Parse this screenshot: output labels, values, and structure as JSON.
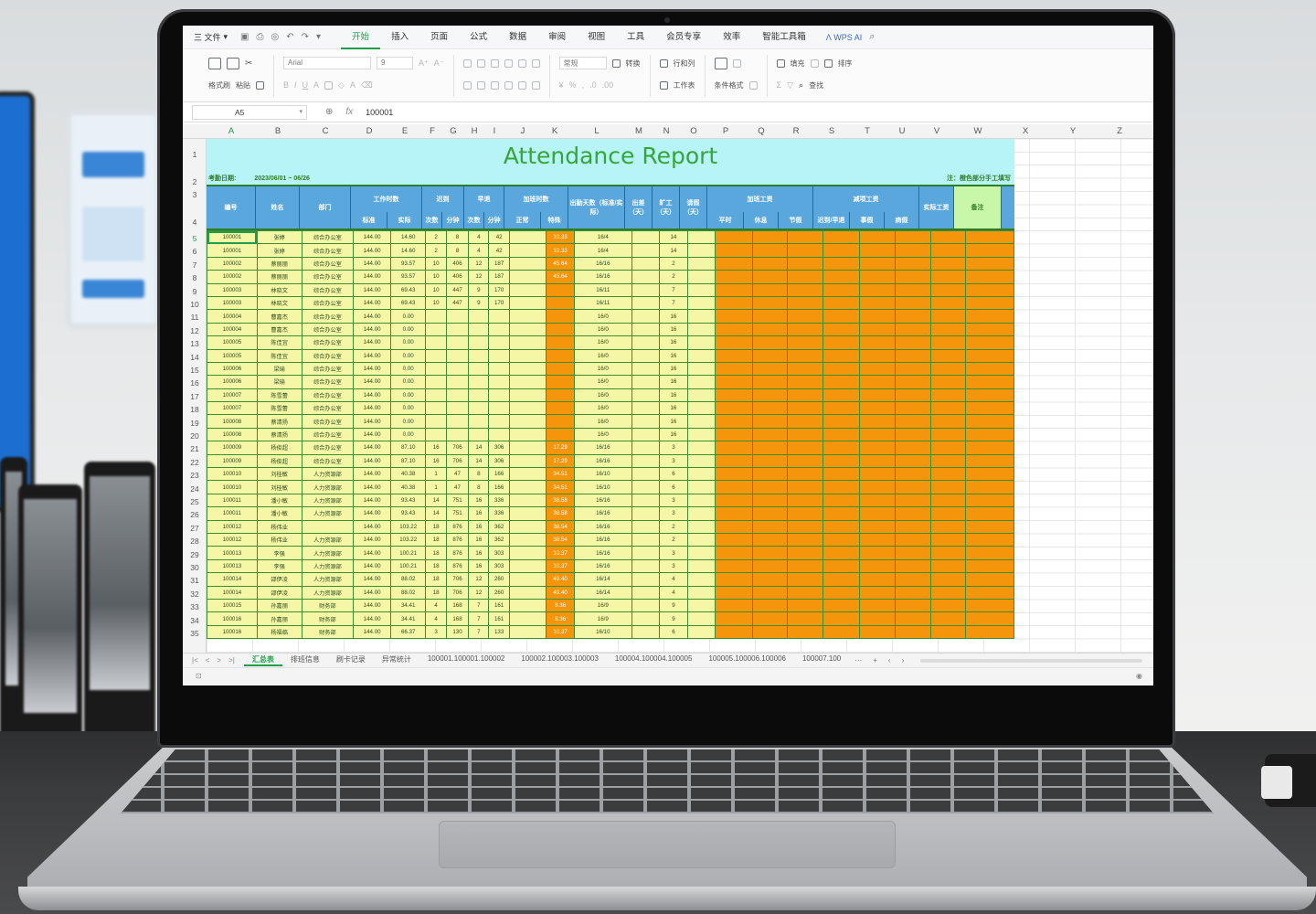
{
  "menubar": {
    "file": "三 文件",
    "tabs": [
      "开始",
      "插入",
      "页面",
      "公式",
      "数据",
      "审阅",
      "视图",
      "工具",
      "会员专享",
      "效率",
      "智能工具箱"
    ],
    "active_tab": "开始",
    "ai_label": "WPS AI"
  },
  "ribbon": {
    "format_painter": "格式刷",
    "paste": "粘贴",
    "font_name": "Arial",
    "font_size": "9",
    "number_format": "常规",
    "convert": "转换",
    "rows_cols": "行和列",
    "worksheet": "工作表",
    "conditional_format": "条件格式",
    "fill": "填充",
    "sort": "排序",
    "find": "查找"
  },
  "formula_bar": {
    "cell_ref": "A5",
    "fx": "fx",
    "value": "100001"
  },
  "columns": [
    "A",
    "B",
    "C",
    "D",
    "E",
    "F",
    "G",
    "H",
    "I",
    "J",
    "K",
    "L",
    "M",
    "N",
    "O",
    "P",
    "Q",
    "R",
    "S",
    "T",
    "U",
    "V",
    "W",
    "X",
    "Y",
    "Z"
  ],
  "selected_column": "A",
  "selected_row": "5",
  "rows": [
    "1",
    "2",
    "3",
    "4",
    "5",
    "6",
    "7",
    "8",
    "9",
    "10",
    "11",
    "12",
    "13",
    "14",
    "15",
    "16",
    "17",
    "18",
    "19",
    "20",
    "21",
    "22",
    "23",
    "24",
    "25",
    "26",
    "27",
    "28",
    "29",
    "30",
    "31",
    "32",
    "33",
    "34",
    "35"
  ],
  "report": {
    "title": "Attendance Report",
    "date_label": "考勤日期:",
    "date_value": "2023/06/01 ~ 06/26",
    "note": "注：橙色部分手工填写",
    "headers": {
      "id": "编号",
      "name": "姓名",
      "dept": "部门",
      "work_hours": "工作时数",
      "work_std": "标准",
      "work_actual": "实际",
      "late": "迟到",
      "late_times": "次数",
      "late_min": "分钟",
      "early": "早退",
      "early_times": "次数",
      "early_min": "分钟",
      "overtime": "加班时数",
      "ot_normal": "正常",
      "ot_special": "特殊",
      "attend_days": "出勤天数（标准/实际）",
      "leave_days": "出差（天）",
      "absent_days": "旷工（天）",
      "leave": "请假（天）",
      "ot_pay": "加班工资",
      "ot_weekday": "平时",
      "ot_weekend": "休息",
      "ot_holiday": "节假",
      "deduction": "减项工资",
      "ded_late": "迟到/早退",
      "ded_leave": "事假",
      "ded_sick": "病假",
      "real_wage": "实际工资",
      "remark": "备注"
    },
    "records": [
      {
        "id": "100001",
        "name": "张婷",
        "dept": "综合办公室",
        "std": "144.00",
        "act": "14.60",
        "lt": "2",
        "lm": "8",
        "et": "4",
        "em": "42",
        "ot": "10.33",
        "days": "16/4",
        "abs": "14"
      },
      {
        "id": "100001",
        "name": "张婷",
        "dept": "综合办公室",
        "std": "144.00",
        "act": "14.60",
        "lt": "2",
        "lm": "8",
        "et": "4",
        "em": "42",
        "ot": "10.33",
        "days": "16/4",
        "abs": "14"
      },
      {
        "id": "100002",
        "name": "蔡丽丽",
        "dept": "综合办公室",
        "std": "144.00",
        "act": "93.57",
        "lt": "10",
        "lm": "406",
        "et": "12",
        "em": "187",
        "ot": "45.64",
        "days": "16/16",
        "abs": "2"
      },
      {
        "id": "100002",
        "name": "蔡丽丽",
        "dept": "综合办公室",
        "std": "144.00",
        "act": "93.57",
        "lt": "10",
        "lm": "406",
        "et": "12",
        "em": "187",
        "ot": "45.64",
        "days": "16/16",
        "abs": "2"
      },
      {
        "id": "100003",
        "name": "林晓文",
        "dept": "综合办公室",
        "std": "144.00",
        "act": "69.43",
        "lt": "10",
        "lm": "447",
        "et": "9",
        "em": "170",
        "ot": "",
        "days": "16/11",
        "abs": "7"
      },
      {
        "id": "100003",
        "name": "林晓文",
        "dept": "综合办公室",
        "std": "144.00",
        "act": "69.43",
        "lt": "10",
        "lm": "447",
        "et": "9",
        "em": "170",
        "ot": "",
        "days": "16/11",
        "abs": "7"
      },
      {
        "id": "100004",
        "name": "曹嘉杰",
        "dept": "综合办公室",
        "std": "144.00",
        "act": "0.00",
        "lt": "",
        "lm": "",
        "et": "",
        "em": "",
        "ot": "",
        "days": "16/0",
        "abs": "16"
      },
      {
        "id": "100004",
        "name": "曹嘉杰",
        "dept": "综合办公室",
        "std": "144.00",
        "act": "0.00",
        "lt": "",
        "lm": "",
        "et": "",
        "em": "",
        "ot": "",
        "days": "16/0",
        "abs": "16"
      },
      {
        "id": "100005",
        "name": "陈佳宜",
        "dept": "综合办公室",
        "std": "144.00",
        "act": "0.00",
        "lt": "",
        "lm": "",
        "et": "",
        "em": "",
        "ot": "",
        "days": "16/0",
        "abs": "16"
      },
      {
        "id": "100005",
        "name": "陈佳宜",
        "dept": "综合办公室",
        "std": "144.00",
        "act": "0.00",
        "lt": "",
        "lm": "",
        "et": "",
        "em": "",
        "ot": "",
        "days": "16/0",
        "abs": "16"
      },
      {
        "id": "100006",
        "name": "梁瑜",
        "dept": "综合办公室",
        "std": "144.00",
        "act": "0.00",
        "lt": "",
        "lm": "",
        "et": "",
        "em": "",
        "ot": "",
        "days": "16/0",
        "abs": "16"
      },
      {
        "id": "100006",
        "name": "梁瑜",
        "dept": "综合办公室",
        "std": "144.00",
        "act": "0.00",
        "lt": "",
        "lm": "",
        "et": "",
        "em": "",
        "ot": "",
        "days": "16/0",
        "abs": "16"
      },
      {
        "id": "100007",
        "name": "陈雪蕾",
        "dept": "综合办公室",
        "std": "144.00",
        "act": "0.00",
        "lt": "",
        "lm": "",
        "et": "",
        "em": "",
        "ot": "",
        "days": "16/0",
        "abs": "16"
      },
      {
        "id": "100007",
        "name": "陈雪蕾",
        "dept": "综合办公室",
        "std": "144.00",
        "act": "0.00",
        "lt": "",
        "lm": "",
        "et": "",
        "em": "",
        "ot": "",
        "days": "16/0",
        "abs": "16"
      },
      {
        "id": "100008",
        "name": "蔡清扬",
        "dept": "综合办公室",
        "std": "144.00",
        "act": "0.00",
        "lt": "",
        "lm": "",
        "et": "",
        "em": "",
        "ot": "",
        "days": "16/0",
        "abs": "16"
      },
      {
        "id": "100008",
        "name": "蔡清扬",
        "dept": "综合办公室",
        "std": "144.00",
        "act": "0.00",
        "lt": "",
        "lm": "",
        "et": "",
        "em": "",
        "ot": "",
        "days": "16/0",
        "abs": "16"
      },
      {
        "id": "100009",
        "name": "杨俊超",
        "dept": "综合办公室",
        "std": "144.00",
        "act": "87.10",
        "lt": "16",
        "lm": "706",
        "et": "14",
        "em": "306",
        "ot": "17.29",
        "days": "16/16",
        "abs": "3"
      },
      {
        "id": "100009",
        "name": "杨俊超",
        "dept": "综合办公室",
        "std": "144.00",
        "act": "87.10",
        "lt": "16",
        "lm": "706",
        "et": "14",
        "em": "306",
        "ot": "17.29",
        "days": "16/16",
        "abs": "3"
      },
      {
        "id": "100010",
        "name": "刘桂敏",
        "dept": "人力资源部",
        "std": "144.00",
        "act": "40.38",
        "lt": "1",
        "lm": "47",
        "et": "8",
        "em": "166",
        "ot": "34.51",
        "days": "16/10",
        "abs": "6"
      },
      {
        "id": "100010",
        "name": "刘桂敏",
        "dept": "人力资源部",
        "std": "144.00",
        "act": "40.38",
        "lt": "1",
        "lm": "47",
        "et": "8",
        "em": "166",
        "ot": "34.51",
        "days": "16/10",
        "abs": "6"
      },
      {
        "id": "100011",
        "name": "潘小敏",
        "dept": "人力资源部",
        "std": "144.00",
        "act": "93.43",
        "lt": "14",
        "lm": "751",
        "et": "16",
        "em": "336",
        "ot": "38.58",
        "days": "16/16",
        "abs": "3"
      },
      {
        "id": "100011",
        "name": "潘小敏",
        "dept": "人力资源部",
        "std": "144.00",
        "act": "93.43",
        "lt": "14",
        "lm": "751",
        "et": "16",
        "em": "336",
        "ot": "38.58",
        "days": "16/16",
        "abs": "3"
      },
      {
        "id": "100012",
        "name": "杨伟业",
        "dept": "",
        "std": "144.00",
        "act": "103.22",
        "lt": "18",
        "lm": "876",
        "et": "16",
        "em": "362",
        "ot": "38.54",
        "days": "16/16",
        "abs": "2"
      },
      {
        "id": "100012",
        "name": "杨伟业",
        "dept": "人力资源部",
        "std": "144.00",
        "act": "103.22",
        "lt": "18",
        "lm": "876",
        "et": "16",
        "em": "362",
        "ot": "38.54",
        "days": "16/16",
        "abs": "2"
      },
      {
        "id": "100013",
        "name": "李强",
        "dept": "人力资源部",
        "std": "144.00",
        "act": "100.21",
        "lt": "18",
        "lm": "876",
        "et": "16",
        "em": "303",
        "ot": "10.37",
        "days": "16/16",
        "abs": "3"
      },
      {
        "id": "100013",
        "name": "李强",
        "dept": "人力资源部",
        "std": "144.00",
        "act": "100.21",
        "lt": "18",
        "lm": "876",
        "et": "16",
        "em": "303",
        "ot": "10.37",
        "days": "16/16",
        "abs": "3"
      },
      {
        "id": "100014",
        "name": "邵伊凌",
        "dept": "人力资源部",
        "std": "144.00",
        "act": "88.02",
        "lt": "18",
        "lm": "706",
        "et": "12",
        "em": "260",
        "ot": "49.40",
        "days": "16/14",
        "abs": "4"
      },
      {
        "id": "100014",
        "name": "邵伊凌",
        "dept": "人力资源部",
        "std": "144.00",
        "act": "88.02",
        "lt": "18",
        "lm": "706",
        "et": "12",
        "em": "260",
        "ot": "49.40",
        "days": "16/14",
        "abs": "4"
      },
      {
        "id": "100015",
        "name": "孙嘉丽",
        "dept": "财务部",
        "std": "144.00",
        "act": "34.41",
        "lt": "4",
        "lm": "168",
        "et": "7",
        "em": "161",
        "ot": "8.36",
        "days": "16/9",
        "abs": "9"
      },
      {
        "id": "100016",
        "name": "孙嘉丽",
        "dept": "财务部",
        "std": "144.00",
        "act": "34.41",
        "lt": "4",
        "lm": "168",
        "et": "7",
        "em": "161",
        "ot": "8.36",
        "days": "16/9",
        "abs": "9"
      },
      {
        "id": "100016",
        "name": "杨福临",
        "dept": "财务部",
        "std": "144.00",
        "act": "66.37",
        "lt": "3",
        "lm": "130",
        "et": "7",
        "em": "133",
        "ot": "10.37",
        "days": "16/10",
        "abs": "6"
      }
    ]
  },
  "sheet_tabs": [
    "汇总表",
    "排班信息",
    "刷卡记录",
    "异常统计",
    "100001.100001.100002",
    "100002.100003.100003",
    "100004.100004.100005",
    "100005.100006.100006",
    "100007.100"
  ],
  "active_sheet": "汇总表",
  "colors": {
    "accent_green": "#1e9e4a",
    "title_bg": "#b7f4f8",
    "header_blue": "#5aa7de",
    "row_yellow": "#f6f7a6",
    "manual_orange": "#f4950b",
    "title_text": "#36a53b"
  }
}
